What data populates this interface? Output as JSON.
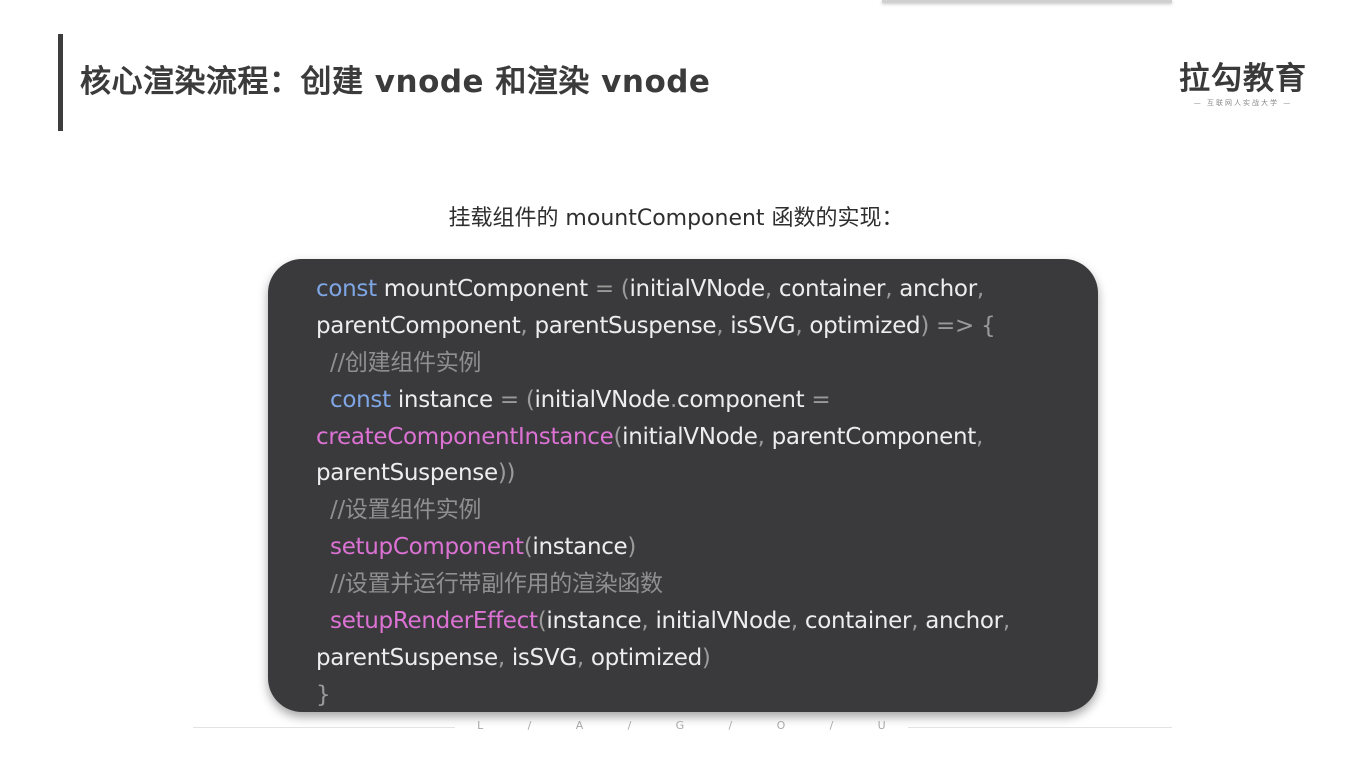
{
  "header": {
    "title": "核心渲染流程：创建 vnode 和渲染 vnode"
  },
  "logo": {
    "main": "拉勾教育",
    "sub": "— 互联网人实战大学 —"
  },
  "subtitle": "挂载组件的 mountComponent 函数的实现：",
  "code_lines": [
    [
      {
        "t": "const",
        "c": "kw"
      },
      {
        "t": " mountComponent ",
        "c": ""
      },
      {
        "t": "= (",
        "c": "pn"
      },
      {
        "t": "initialVNode",
        "c": ""
      },
      {
        "t": ", ",
        "c": "pn"
      },
      {
        "t": "container",
        "c": ""
      },
      {
        "t": ", ",
        "c": "pn"
      },
      {
        "t": "anchor",
        "c": ""
      },
      {
        "t": ",",
        "c": "pn"
      }
    ],
    [
      {
        "t": "parentComponent",
        "c": ""
      },
      {
        "t": ", ",
        "c": "pn"
      },
      {
        "t": "parentSuspense",
        "c": ""
      },
      {
        "t": ", ",
        "c": "pn"
      },
      {
        "t": "isSVG",
        "c": ""
      },
      {
        "t": ", ",
        "c": "pn"
      },
      {
        "t": "optimized",
        "c": ""
      },
      {
        "t": ") => {",
        "c": "pn"
      }
    ],
    [
      {
        "t": "  //创建组件实例",
        "c": "cm"
      }
    ],
    [
      {
        "t": "  const",
        "c": "kw"
      },
      {
        "t": " instance ",
        "c": ""
      },
      {
        "t": "= (",
        "c": "pn"
      },
      {
        "t": "initialVNode",
        "c": ""
      },
      {
        "t": ".",
        "c": "pn"
      },
      {
        "t": "component ",
        "c": ""
      },
      {
        "t": "=",
        "c": "pn"
      }
    ],
    [
      {
        "t": "createComponentInstance",
        "c": "fn"
      },
      {
        "t": "(",
        "c": "pn"
      },
      {
        "t": "initialVNode",
        "c": ""
      },
      {
        "t": ", ",
        "c": "pn"
      },
      {
        "t": "parentComponent",
        "c": ""
      },
      {
        "t": ",",
        "c": "pn"
      }
    ],
    [
      {
        "t": "parentSuspense",
        "c": ""
      },
      {
        "t": "))",
        "c": "pn"
      }
    ],
    [
      {
        "t": "  //设置组件实例",
        "c": "cm"
      }
    ],
    [
      {
        "t": "  setupComponent",
        "c": "fn"
      },
      {
        "t": "(",
        "c": "pn"
      },
      {
        "t": "instance",
        "c": ""
      },
      {
        "t": ")",
        "c": "pn"
      }
    ],
    [
      {
        "t": "  //设置并运行带副作用的渲染函数",
        "c": "cm"
      }
    ],
    [
      {
        "t": "  setupRenderEffect",
        "c": "fn"
      },
      {
        "t": "(",
        "c": "pn"
      },
      {
        "t": "instance",
        "c": ""
      },
      {
        "t": ", ",
        "c": "pn"
      },
      {
        "t": "initialVNode",
        "c": ""
      },
      {
        "t": ", ",
        "c": "pn"
      },
      {
        "t": "container",
        "c": ""
      },
      {
        "t": ", ",
        "c": "pn"
      },
      {
        "t": "anchor",
        "c": ""
      },
      {
        "t": ",",
        "c": "pn"
      }
    ],
    [
      {
        "t": "parentSuspense",
        "c": ""
      },
      {
        "t": ", ",
        "c": "pn"
      },
      {
        "t": "isSVG",
        "c": ""
      },
      {
        "t": ", ",
        "c": "pn"
      },
      {
        "t": "optimized",
        "c": ""
      },
      {
        "t": ")",
        "c": "pn"
      }
    ],
    [
      {
        "t": "}",
        "c": "pn"
      }
    ]
  ],
  "footer": {
    "letters": [
      "L",
      "/",
      "A",
      "/",
      "G",
      "/",
      "O",
      "/",
      "U"
    ]
  }
}
